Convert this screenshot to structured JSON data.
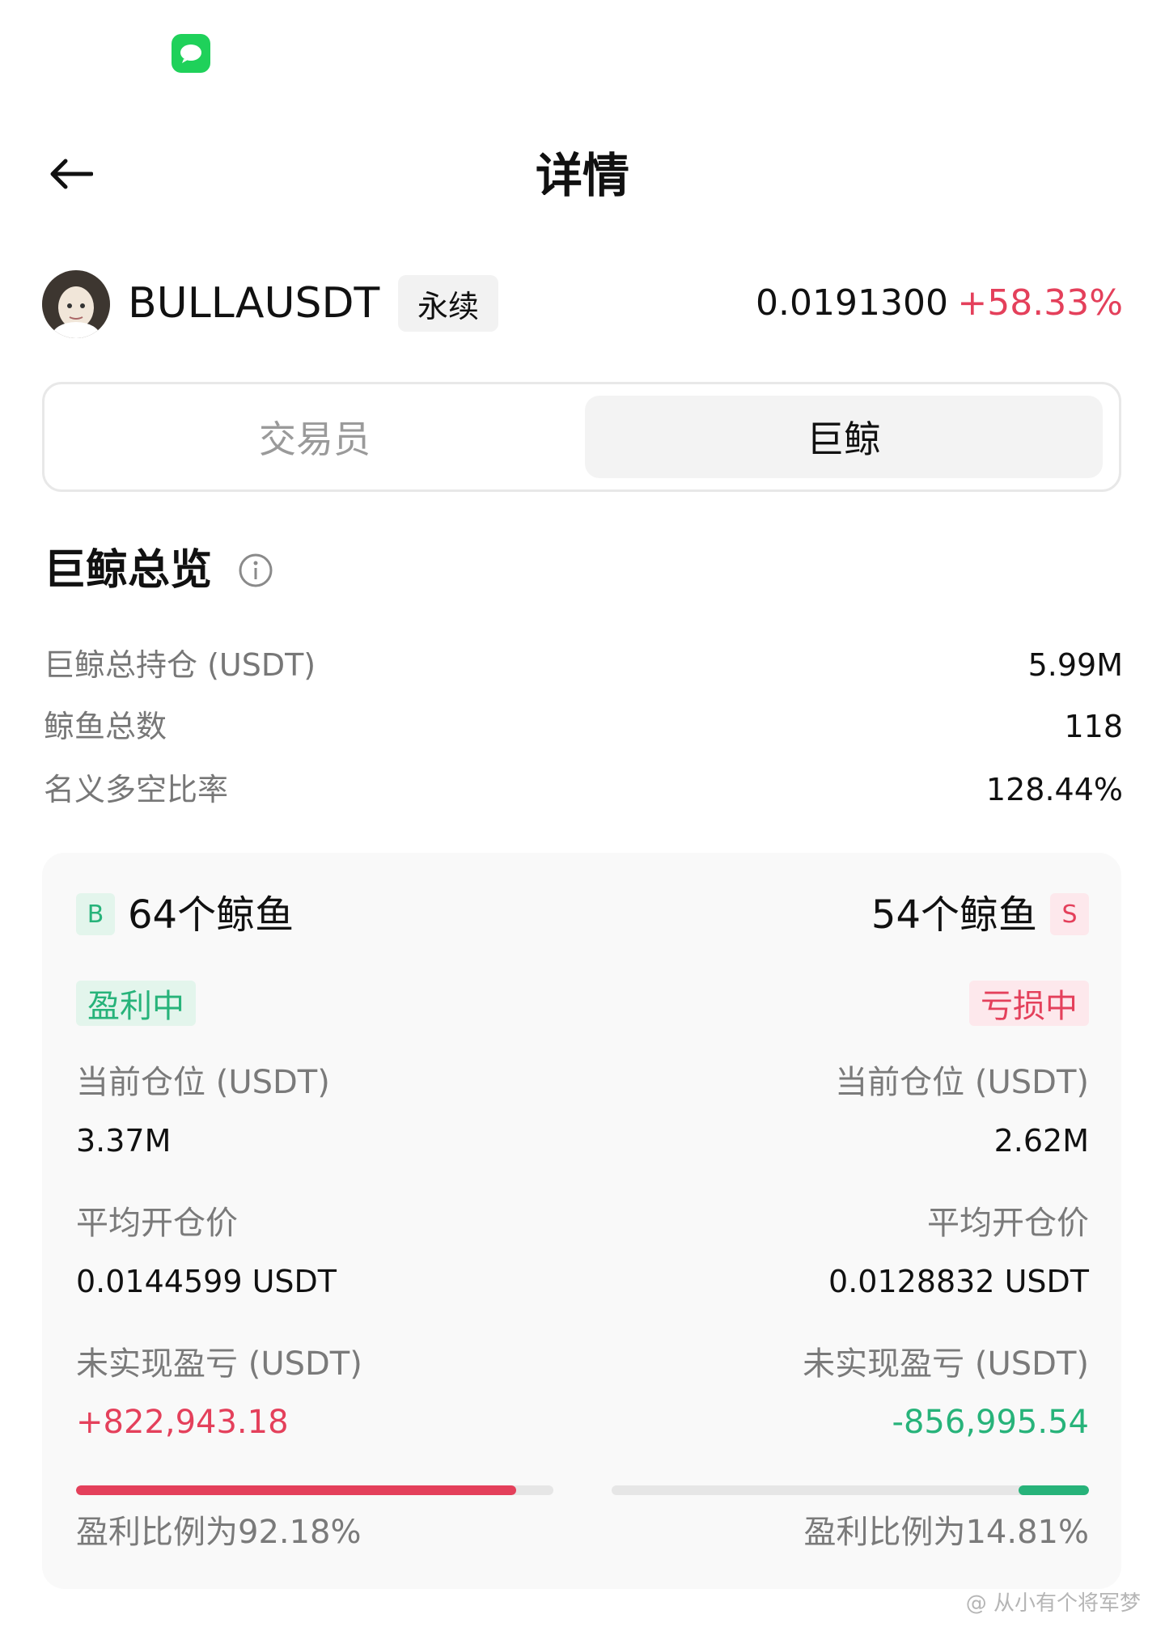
{
  "header": {
    "title": "详情",
    "back_icon": "arrow-left-icon"
  },
  "status_bar": {
    "notification_icon": "message-icon"
  },
  "symbol": {
    "name": "BULLAUSDT",
    "badge": "永续",
    "price": "0.0191300",
    "change": "+58.33%"
  },
  "tabs": [
    {
      "label": "交易员",
      "active": false
    },
    {
      "label": "巨鲸",
      "active": true
    }
  ],
  "overview": {
    "title": "巨鲸总览",
    "info_icon": "info-icon",
    "rows": [
      {
        "label": "巨鲸总持仓 (USDT)",
        "value": "5.99M"
      },
      {
        "label": "鲸鱼总数",
        "value": "118"
      },
      {
        "label": "名义多空比率",
        "value": "128.44%"
      }
    ]
  },
  "long": {
    "badge": "B",
    "count": "64个鲸鱼",
    "status": "盈利中",
    "position_label": "当前仓位 (USDT)",
    "position_value": "3.37M",
    "avg_price_label": "平均开仓价",
    "avg_price_value": "0.0144599 USDT",
    "pnl_label": "未实现盈亏 (USDT)",
    "pnl_value": "+822,943.18",
    "profit_ratio_text": "盈利比例为92.18%",
    "profit_ratio": 0.9218,
    "bar_color": "#e4405b"
  },
  "short": {
    "badge": "S",
    "count": "54个鲸鱼",
    "status": "亏损中",
    "position_label": "当前仓位 (USDT)",
    "position_value": "2.62M",
    "avg_price_label": "平均开仓价",
    "avg_price_value": "0.0128832 USDT",
    "pnl_label": "未实现盈亏 (USDT)",
    "pnl_value": "-856,995.54",
    "profit_ratio_text": "盈利比例为14.81%",
    "profit_ratio": 0.1481,
    "bar_color": "#27b37a"
  },
  "watermark": "@ 从小有个将军梦",
  "colors": {
    "up": "#e4405b",
    "down": "#27b37a"
  }
}
